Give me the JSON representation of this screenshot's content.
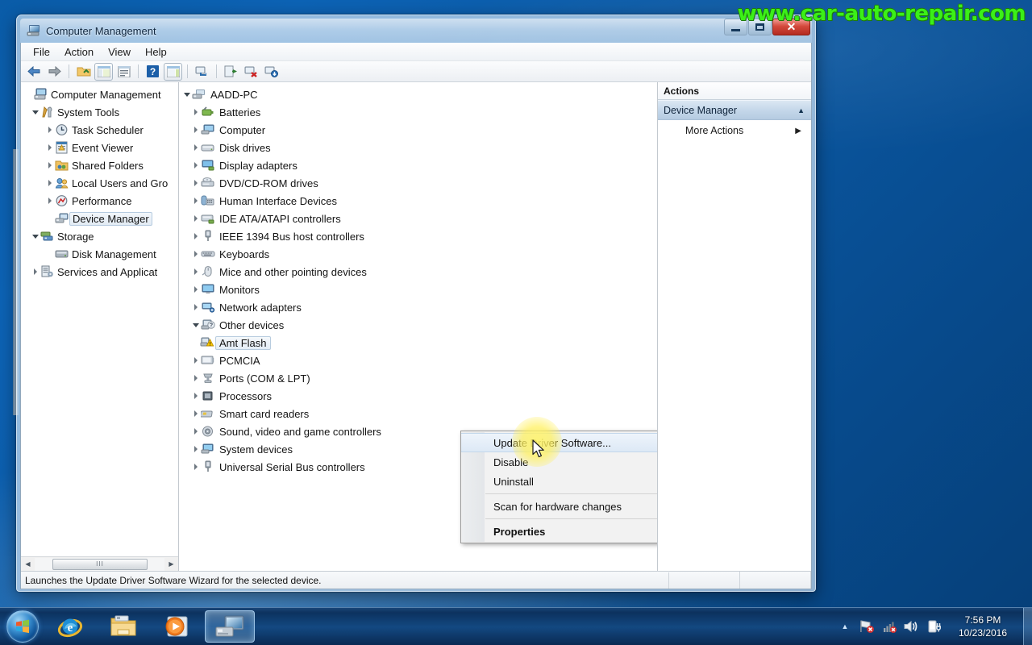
{
  "watermark": "www.car-auto-repair.com",
  "window": {
    "title": "Computer Management",
    "title_icon": "computer-management-icon",
    "buttons": {
      "minimize": "Minimize",
      "maximize": "Maximize",
      "close": "Close"
    }
  },
  "menubar": {
    "items": [
      "File",
      "Action",
      "View",
      "Help"
    ]
  },
  "toolbar": {
    "items": [
      {
        "name": "back-icon",
        "glyph": "←"
      },
      {
        "name": "forward-icon",
        "glyph": "→"
      },
      {
        "name": "up-folder-icon",
        "glyph": "folder"
      },
      {
        "name": "show-hide-console-tree-icon",
        "glyph": "tree"
      },
      {
        "name": "properties-icon",
        "glyph": "props"
      },
      {
        "name": "help-icon",
        "glyph": "?"
      },
      {
        "name": "show-hide-action-pane-icon",
        "glyph": "pane"
      },
      {
        "name": "scan-hardware-changes-icon",
        "glyph": "scan"
      },
      {
        "name": "update-driver-icon",
        "glyph": "update"
      },
      {
        "name": "uninstall-device-icon",
        "glyph": "uninstall"
      },
      {
        "name": "install-legacy-hardware-icon",
        "glyph": "install"
      }
    ]
  },
  "console_tree": {
    "root": {
      "label": "Computer Management",
      "icon": "computer-management-icon"
    },
    "items": [
      {
        "label": "System Tools",
        "icon": "system-tools-icon",
        "indent": 1,
        "expander": "open"
      },
      {
        "label": "Task Scheduler",
        "icon": "task-scheduler-icon",
        "indent": 2,
        "expander": "closed"
      },
      {
        "label": "Event Viewer",
        "icon": "event-viewer-icon",
        "indent": 2,
        "expander": "closed"
      },
      {
        "label": "Shared Folders",
        "icon": "shared-folders-icon",
        "indent": 2,
        "expander": "closed"
      },
      {
        "label": "Local Users and Gro",
        "icon": "local-users-groups-icon",
        "indent": 2,
        "expander": "closed"
      },
      {
        "label": "Performance",
        "icon": "performance-icon",
        "indent": 2,
        "expander": "closed"
      },
      {
        "label": "Device Manager",
        "icon": "device-manager-icon",
        "indent": 2,
        "expander": "none",
        "selected": true
      },
      {
        "label": "Storage",
        "icon": "storage-icon",
        "indent": 1,
        "expander": "open"
      },
      {
        "label": "Disk Management",
        "icon": "disk-management-icon",
        "indent": 2,
        "expander": "none"
      },
      {
        "label": "Services and Applicat",
        "icon": "services-applications-icon",
        "indent": 1,
        "expander": "closed"
      }
    ],
    "hscroll": {
      "left_arrow": "◀",
      "right_arrow": "▶",
      "grip": "III"
    }
  },
  "device_tree": {
    "root": {
      "label": "AADD-PC",
      "icon": "computer-node-icon",
      "expander": "open"
    },
    "items": [
      {
        "label": "Batteries",
        "icon": "batteries-icon",
        "expander": "closed"
      },
      {
        "label": "Computer",
        "icon": "computer-icon",
        "expander": "closed"
      },
      {
        "label": "Disk drives",
        "icon": "disk-drives-icon",
        "expander": "closed"
      },
      {
        "label": "Display adapters",
        "icon": "display-adapters-icon",
        "expander": "closed"
      },
      {
        "label": "DVD/CD-ROM drives",
        "icon": "dvd-cdrom-icon",
        "expander": "closed"
      },
      {
        "label": "Human Interface Devices",
        "icon": "hid-icon",
        "expander": "closed"
      },
      {
        "label": "IDE ATA/ATAPI controllers",
        "icon": "ide-controllers-icon",
        "expander": "closed"
      },
      {
        "label": "IEEE 1394 Bus host controllers",
        "icon": "ieee1394-icon",
        "expander": "closed"
      },
      {
        "label": "Keyboards",
        "icon": "keyboards-icon",
        "expander": "closed"
      },
      {
        "label": "Mice and other pointing devices",
        "icon": "mice-icon",
        "expander": "closed"
      },
      {
        "label": "Monitors",
        "icon": "monitors-icon",
        "expander": "closed"
      },
      {
        "label": "Network adapters",
        "icon": "network-adapters-icon",
        "expander": "closed"
      },
      {
        "label": "Other devices",
        "icon": "other-devices-icon",
        "expander": "open"
      },
      {
        "label": "Amt Flash",
        "icon": "unknown-device-warning-icon",
        "expander": "none",
        "child": true,
        "selected": true
      },
      {
        "label": "PCMCIA",
        "icon": "pcmcia-icon",
        "expander": "closed"
      },
      {
        "label": "Ports (COM & LPT)",
        "icon": "ports-icon",
        "expander": "closed"
      },
      {
        "label": "Processors",
        "icon": "processors-icon",
        "expander": "closed"
      },
      {
        "label": "Smart card readers",
        "icon": "smart-card-icon",
        "expander": "closed"
      },
      {
        "label": "Sound, video and game controllers",
        "icon": "sound-video-icon",
        "expander": "closed"
      },
      {
        "label": "System devices",
        "icon": "system-devices-icon",
        "expander": "closed"
      },
      {
        "label": "Universal Serial Bus controllers",
        "icon": "usb-controllers-icon",
        "expander": "closed"
      }
    ]
  },
  "context_menu": {
    "items": [
      {
        "label": "Update Driver Software...",
        "highlighted": true
      },
      {
        "label": "Disable"
      },
      {
        "label": "Uninstall"
      },
      {
        "separator": true
      },
      {
        "label": "Scan for hardware changes"
      },
      {
        "separator": true
      },
      {
        "label": "Properties",
        "bold": true
      }
    ]
  },
  "actions_pane": {
    "header": "Actions",
    "group": "Device Manager",
    "collapse_glyph": "▲",
    "items": [
      {
        "label": "More Actions",
        "submenu_glyph": "▶"
      }
    ]
  },
  "status_bar": {
    "text": "Launches the Update Driver Software Wizard for the selected device."
  },
  "taskbar": {
    "start": "start-orb",
    "buttons": [
      {
        "name": "internet-explorer-icon",
        "active": false
      },
      {
        "name": "windows-explorer-icon",
        "active": false
      },
      {
        "name": "windows-media-player-icon",
        "active": false
      },
      {
        "name": "computer-management-taskbar-icon",
        "active": true
      }
    ],
    "tray": {
      "show_hidden_glyph": "▲",
      "icons": [
        "network-error-icon",
        "action-center-icon",
        "volume-icon",
        "power-icon"
      ],
      "time": "7:56 PM",
      "date": "10/23/2016"
    }
  },
  "colors": {
    "desktop_blue": "#0b59a4",
    "accent_selection": "#cfe0f0",
    "close_red": "#d4493c",
    "watermark_green": "#3bf018",
    "warning_yellow": "#ffcc00"
  }
}
